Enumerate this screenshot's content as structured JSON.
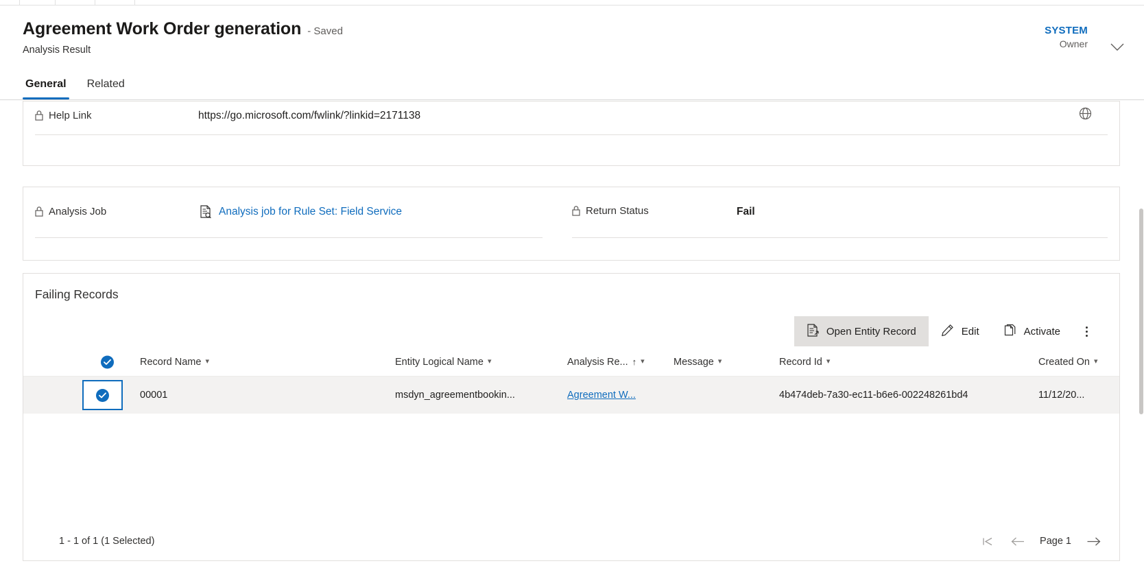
{
  "header": {
    "record_title": "Agreement Work Order generation",
    "save_state": "- Saved",
    "entity_name": "Analysis Result",
    "owner_name": "SYSTEM",
    "owner_role": "Owner",
    "owner_chevron_icon": "chevron-down-icon",
    "tabs": [
      {
        "label": "General",
        "active": true
      },
      {
        "label": "Related",
        "active": false
      }
    ]
  },
  "help_section": {
    "label": "Help Link",
    "label_icon": "lock-icon",
    "value": "https://go.microsoft.com/fwlink/?linkid=2171138",
    "trailing_icon": "globe-icon"
  },
  "job_section": {
    "analysis_job": {
      "label": "Analysis Job",
      "label_icon": "lock-icon",
      "value_icon": "document-search-icon",
      "value": "Analysis job for Rule Set: Field Service"
    },
    "return_status": {
      "label": "Return Status",
      "label_icon": "lock-icon",
      "value": "Fail"
    }
  },
  "failing_records": {
    "heading": "Failing Records",
    "commands": [
      {
        "label": "Open Entity Record",
        "icon": "open-entity-record-icon",
        "selected": true
      },
      {
        "label": "Edit",
        "icon": "pencil-icon",
        "selected": false
      },
      {
        "label": "Activate",
        "icon": "activate-page-icon",
        "selected": false
      }
    ],
    "overflow_icon": "more-vertical-icon",
    "columns": [
      {
        "label": "Record Name",
        "sorted": false
      },
      {
        "label": "Entity Logical Name",
        "sorted": false
      },
      {
        "label": "Analysis Re...",
        "sorted": true,
        "sort_dir": "ascending"
      },
      {
        "label": "Message",
        "sorted": false
      },
      {
        "label": "Record Id",
        "sorted": false
      },
      {
        "label": "Created On",
        "sorted": false
      }
    ],
    "select_all_checked": true,
    "rows": [
      {
        "selected": true,
        "record_name": "00001",
        "entity_logical_name": "msdyn_agreementbookin...",
        "analysis_result": "Agreement W...",
        "message": "",
        "record_id": "4b474deb-7a30-ec11-b6e6-002248261bd4",
        "created_on": "11/12/20..."
      }
    ],
    "footer": {
      "count_text": "1 - 1 of 1 (1 Selected)",
      "first_page_icon": "first-page-icon",
      "prev_page_icon": "arrow-left-icon",
      "page_label": "Page 1",
      "next_page_icon": "arrow-right-icon"
    }
  },
  "colors": {
    "accent": "#0f6cbd",
    "row_selected_bg": "#f3f2f1",
    "command_selected_bg": "#e1dfdd"
  }
}
